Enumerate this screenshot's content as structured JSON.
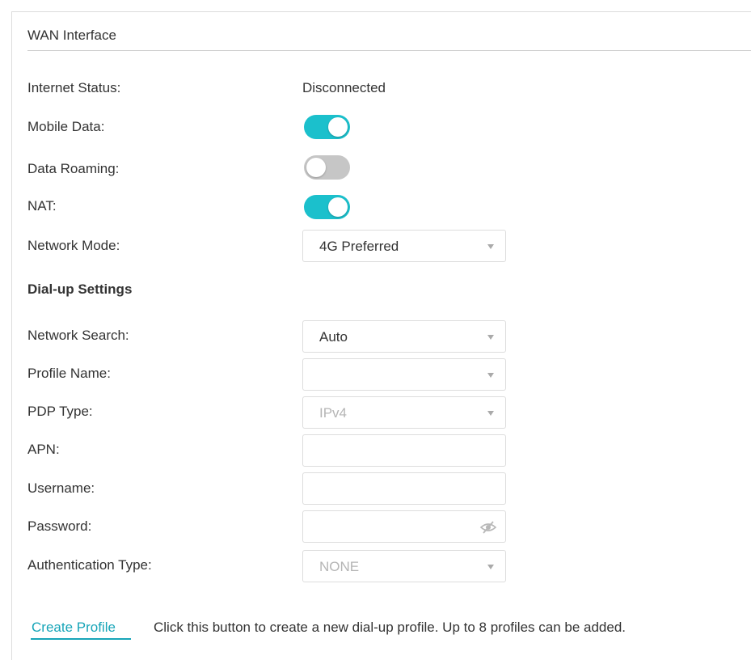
{
  "panel": {
    "title": "WAN Interface"
  },
  "status": {
    "label": "Internet Status:",
    "value": "Disconnected"
  },
  "mobile_data": {
    "label": "Mobile Data:",
    "enabled": true
  },
  "data_roaming": {
    "label": "Data Roaming:",
    "enabled": false
  },
  "nat": {
    "label": "NAT:",
    "enabled": true
  },
  "network_mode": {
    "label": "Network Mode:",
    "value": "4G Preferred"
  },
  "dialup": {
    "heading": "Dial-up Settings",
    "network_search": {
      "label": "Network Search:",
      "value": "Auto"
    },
    "profile_name": {
      "label": "Profile Name:",
      "value": ""
    },
    "pdp_type": {
      "label": "PDP Type:",
      "value": "IPv4"
    },
    "apn": {
      "label": "APN:",
      "value": ""
    },
    "username": {
      "label": "Username:",
      "value": ""
    },
    "password": {
      "label": "Password:",
      "value": ""
    },
    "auth_type": {
      "label": "Authentication Type:",
      "value": "NONE"
    }
  },
  "footer": {
    "create_profile": "Create Profile",
    "hint": "Click this button to create a new dial-up profile. Up to 8 profiles can be added."
  },
  "colors": {
    "accent": "#1bc0cc",
    "link": "#17a5b8",
    "toggle_off": "#c6c6c6"
  },
  "icons": {
    "password_visibility": "eye-slash-icon",
    "dropdown": "caret-down-icon"
  }
}
